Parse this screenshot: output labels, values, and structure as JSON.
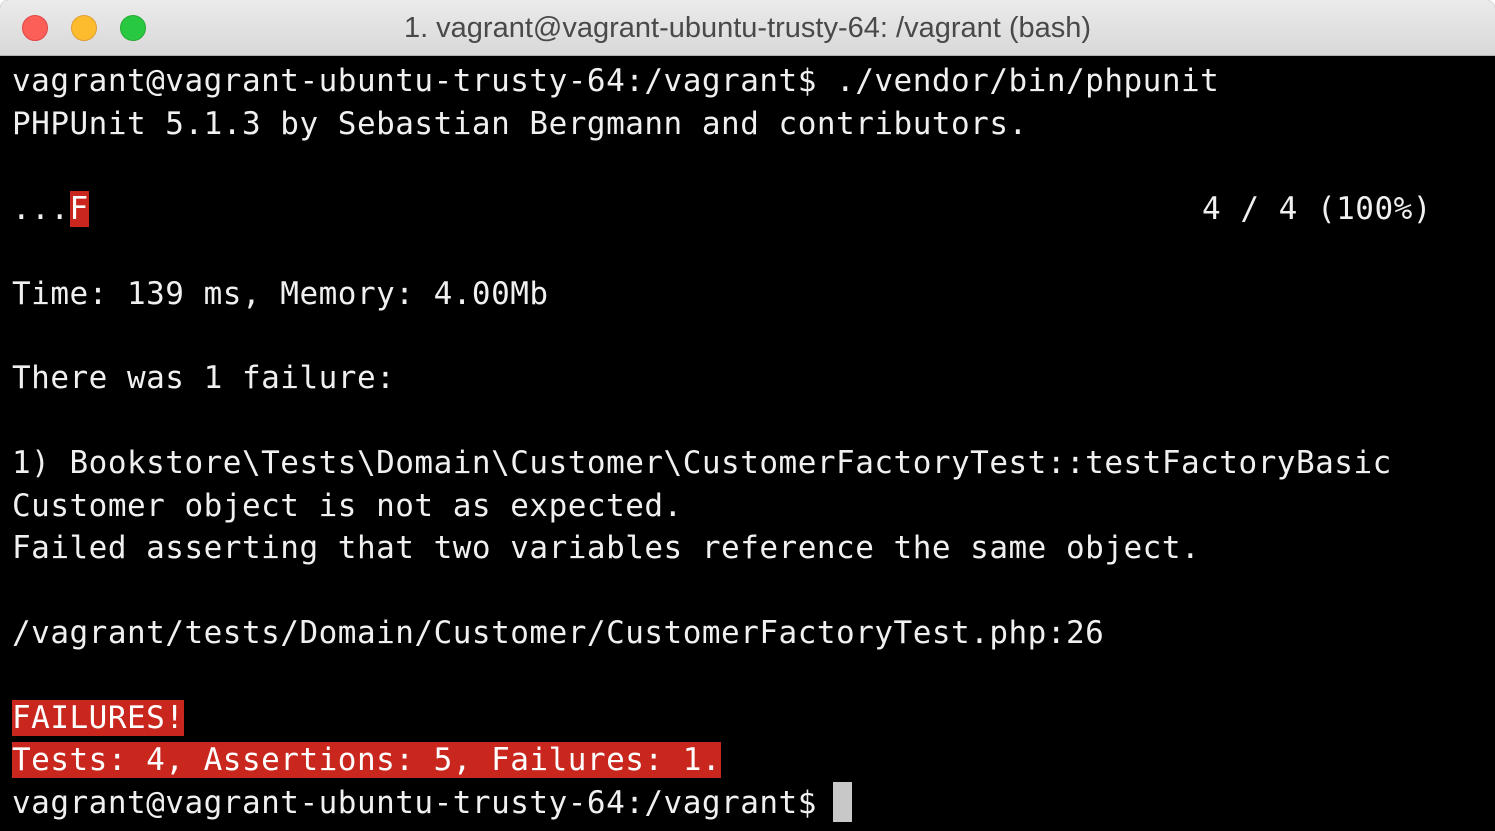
{
  "window": {
    "title": "1. vagrant@vagrant-ubuntu-trusty-64: /vagrant (bash)"
  },
  "terminal": {
    "prompt1": "vagrant@vagrant-ubuntu-trusty-64:/vagrant$",
    "command1": " ./vendor/bin/phpunit",
    "banner": "PHPUnit 5.1.3 by Sebastian Bergmann and contributors.",
    "progress_dots": "...",
    "progress_fail": "F",
    "progress_count": "4 / 4 (100%)",
    "timing": "Time: 139 ms, Memory: 4.00Mb",
    "failure_header": "There was 1 failure:",
    "failure_test": "1) Bookstore\\Tests\\Domain\\Customer\\CustomerFactoryTest::testFactoryBasic",
    "failure_message": "Customer object is not as expected.",
    "failure_assertion": "Failed asserting that two variables reference the same object.",
    "failure_location": "/vagrant/tests/Domain/Customer/CustomerFactoryTest.php:26",
    "summary_status": "FAILURES!",
    "summary_counts": "Tests: 4, Assertions: 5, Failures: 1.",
    "prompt2": "vagrant@vagrant-ubuntu-trusty-64:/vagrant$"
  },
  "colors": {
    "failure_highlight": "#c9261d",
    "background": "#000000",
    "foreground": "#f0f0f0"
  }
}
